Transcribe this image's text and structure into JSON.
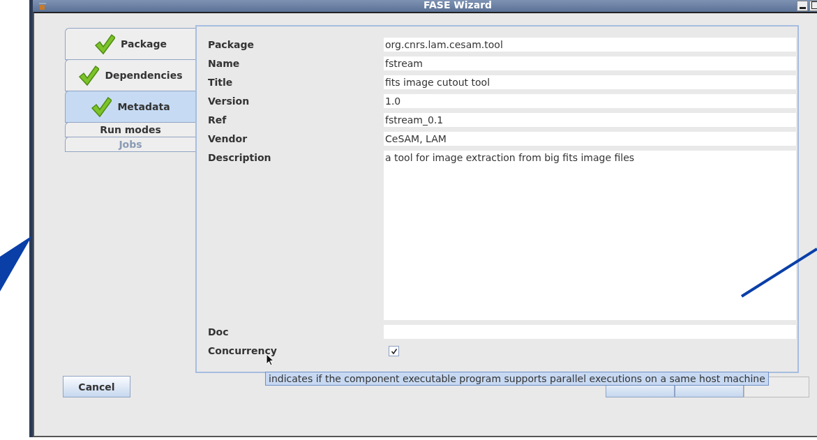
{
  "window": {
    "title": "FASE Wizard"
  },
  "tabs": [
    {
      "label": "Package",
      "done": true,
      "selected": false,
      "disabled": false
    },
    {
      "label": "Dependencies",
      "done": true,
      "selected": false,
      "disabled": false
    },
    {
      "label": "Metadata",
      "done": true,
      "selected": true,
      "disabled": false
    },
    {
      "label": "Run modes",
      "done": false,
      "selected": false,
      "disabled": false
    },
    {
      "label": "Jobs",
      "done": false,
      "selected": false,
      "disabled": true
    }
  ],
  "fields": [
    {
      "kind": "text",
      "label": "Package",
      "value": "org.cnrs.lam.cesam.tool"
    },
    {
      "kind": "text",
      "label": "Name",
      "value": "fstream"
    },
    {
      "kind": "text",
      "label": "Title",
      "value": "fits image cutout tool"
    },
    {
      "kind": "text",
      "label": "Version",
      "value": "1.0"
    },
    {
      "kind": "text",
      "label": "Ref",
      "value": "fstream_0.1"
    },
    {
      "kind": "text",
      "label": "Vendor",
      "value": "CeSAM, LAM"
    },
    {
      "kind": "textarea",
      "label": "Description",
      "value": "a tool for image extraction from big fits image files"
    },
    {
      "kind": "text",
      "label": "Doc"
    },
    {
      "kind": "checkbox",
      "label": "Concurrency",
      "checked": true
    }
  ],
  "tooltip": "indicates if the component executable program supports parallel executions on a same host machine",
  "cancel_button": "Cancel",
  "nav_buttons": [
    {
      "disabled": false
    },
    {
      "disabled": false
    },
    {
      "disabled": true
    }
  ]
}
